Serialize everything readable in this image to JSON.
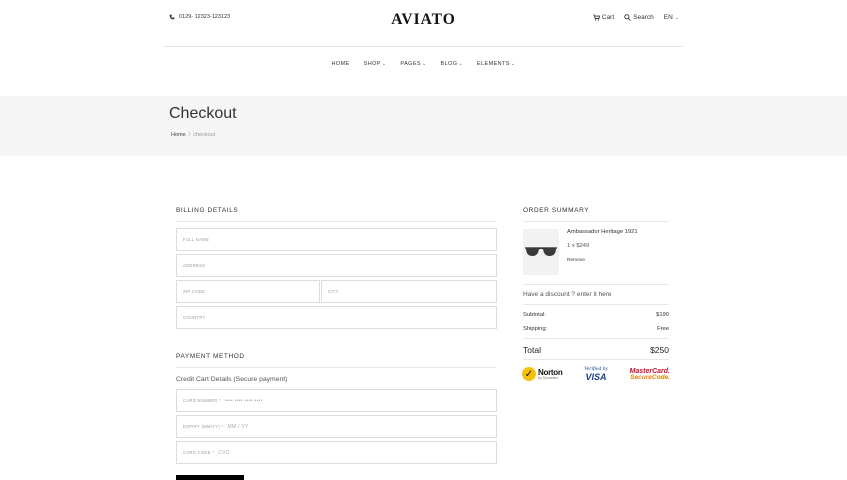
{
  "header": {
    "phone": "0129- 12323-123123",
    "logo": "AVIATO",
    "cart_label": "Cart",
    "search_label": "Search",
    "language": "EN"
  },
  "nav": {
    "items": [
      {
        "label": "HOME",
        "has_dropdown": false
      },
      {
        "label": "SHOP",
        "has_dropdown": true
      },
      {
        "label": "PAGES",
        "has_dropdown": true
      },
      {
        "label": "BLOG",
        "has_dropdown": true
      },
      {
        "label": "ELEMENTS",
        "has_dropdown": true
      }
    ]
  },
  "page": {
    "title": "Checkout",
    "breadcrumb": [
      "Home",
      "checkout"
    ],
    "breadcrumb_separator": "/"
  },
  "billing": {
    "title": "BILLING DETAILS",
    "fields": {
      "full_name": "FULL NAME",
      "address": "ADDRESS",
      "zip": "ZIP CODE",
      "city": "CITY",
      "country": "COUNTRY"
    }
  },
  "payment": {
    "title": "PAYMENT METHOD",
    "subtitle": "Credit Cart Details (Secure payment)",
    "card_number_label": "CARD NUMBER *",
    "card_number_placeholder": "•••• •••• •••• ••••",
    "expiry_label": "EXPIRY (MM/YY) *",
    "expiry_placeholder": "MM / YY",
    "card_code_label": "CARD CODE *",
    "card_code_placeholder": "CVC"
  },
  "order": {
    "title": "ORDER SUMMARY",
    "product_name": "Ambassador Heritage 1921",
    "product_price": "1 x $249",
    "remove_label": "Remove",
    "discount_text": "Have a discount ? enter it here",
    "subtotal_label": "Subtotal:",
    "subtotal_value": "$190",
    "shipping_label": "Shipping:",
    "shipping_value": "Free",
    "total_label": "Total",
    "total_value": "$250"
  },
  "badges": {
    "norton_name": "Norton",
    "norton_sub": "by Symantec",
    "visa_top": "Verified by",
    "visa_main": "VISA",
    "mastercard_top": "MasterCard.",
    "mastercard_main": "SecureCode."
  },
  "colors": {
    "header_band": "#f5f5f5",
    "button": "#000000",
    "mastercard_red": "#c8102e",
    "visa_blue": "#1a3f8f",
    "norton_yellow": "#f4c20d"
  }
}
